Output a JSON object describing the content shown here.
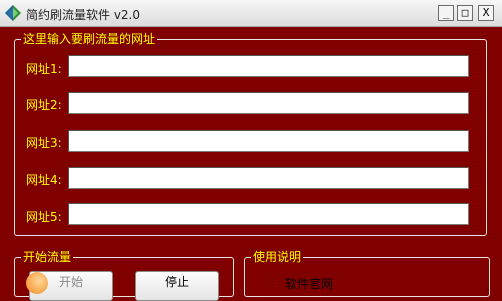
{
  "window": {
    "title": "简约刷流量软件 v2.0",
    "minimize_glyph": "_",
    "maximize_glyph": "□",
    "close_glyph": "X"
  },
  "url_group": {
    "legend": "这里输入要刷流量的网址",
    "rows": [
      {
        "label": "网址1:",
        "value": ""
      },
      {
        "label": "网址2:",
        "value": ""
      },
      {
        "label": "网址3:",
        "value": ""
      },
      {
        "label": "网址4:",
        "value": ""
      },
      {
        "label": "网址5:",
        "value": ""
      }
    ]
  },
  "start_group": {
    "legend": "开始流量",
    "start_label": "开始",
    "stop_label": "停止"
  },
  "help_group": {
    "legend": "使用说明",
    "text": "软件官网"
  },
  "colors": {
    "background": "#800000",
    "legend_text": "#ffff00",
    "border": "#e6e6e6"
  }
}
